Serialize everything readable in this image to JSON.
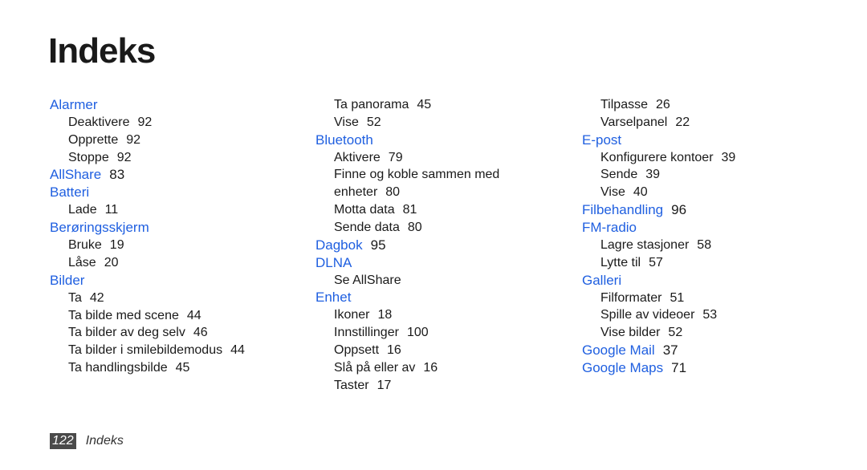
{
  "title": "Indeks",
  "footer": {
    "page_number": "122",
    "label": "Indeks"
  },
  "columns": [
    {
      "entries": [
        {
          "heading": "Alarmer",
          "page": "",
          "subs": [
            {
              "text": "Deaktivere",
              "page": "92"
            },
            {
              "text": "Opprette",
              "page": "92"
            },
            {
              "text": "Stoppe",
              "page": "92"
            }
          ]
        },
        {
          "heading": "AllShare",
          "page": "83",
          "subs": []
        },
        {
          "heading": "Batteri",
          "page": "",
          "subs": [
            {
              "text": "Lade",
              "page": "11"
            }
          ]
        },
        {
          "heading": "Berøringsskjerm",
          "page": "",
          "subs": [
            {
              "text": "Bruke",
              "page": "19"
            },
            {
              "text": "Låse",
              "page": "20"
            }
          ]
        },
        {
          "heading": "Bilder",
          "page": "",
          "subs": [
            {
              "text": "Ta",
              "page": "42"
            },
            {
              "text": "Ta bilde med scene",
              "page": "44"
            },
            {
              "text": "Ta bilder av deg selv",
              "page": "46"
            },
            {
              "text": "Ta bilder i smilebildemodus",
              "page": "44"
            },
            {
              "text": "Ta handlingsbilde",
              "page": "45"
            }
          ]
        }
      ]
    },
    {
      "continued": [
        {
          "text": "Ta panorama",
          "page": "45"
        },
        {
          "text": "Vise",
          "page": "52"
        }
      ],
      "entries": [
        {
          "heading": "Bluetooth",
          "page": "",
          "subs": [
            {
              "text": "Aktivere",
              "page": "79"
            },
            {
              "text": "Finne og koble sammen med enheter",
              "page": "80"
            },
            {
              "text": "Motta data",
              "page": "81"
            },
            {
              "text": "Sende data",
              "page": "80"
            }
          ]
        },
        {
          "heading": "Dagbok",
          "page": "95",
          "subs": []
        },
        {
          "heading": "DLNA",
          "page": "",
          "subs": [
            {
              "text": "Se AllShare",
              "page": ""
            }
          ]
        },
        {
          "heading": "Enhet",
          "page": "",
          "subs": [
            {
              "text": "Ikoner",
              "page": "18"
            },
            {
              "text": "Innstillinger",
              "page": "100"
            },
            {
              "text": "Oppsett",
              "page": "16"
            },
            {
              "text": "Slå på eller av",
              "page": "16"
            },
            {
              "text": "Taster",
              "page": "17"
            }
          ]
        }
      ]
    },
    {
      "continued": [
        {
          "text": "Tilpasse",
          "page": "26"
        },
        {
          "text": "Varselpanel",
          "page": "22"
        }
      ],
      "entries": [
        {
          "heading": "E-post",
          "page": "",
          "subs": [
            {
              "text": "Konfigurere kontoer",
              "page": "39"
            },
            {
              "text": "Sende",
              "page": "39"
            },
            {
              "text": "Vise",
              "page": "40"
            }
          ]
        },
        {
          "heading": "Filbehandling",
          "page": "96",
          "subs": []
        },
        {
          "heading": "FM-radio",
          "page": "",
          "subs": [
            {
              "text": "Lagre stasjoner",
              "page": "58"
            },
            {
              "text": "Lytte til",
              "page": "57"
            }
          ]
        },
        {
          "heading": "Galleri",
          "page": "",
          "subs": [
            {
              "text": "Filformater",
              "page": "51"
            },
            {
              "text": "Spille av videoer",
              "page": "53"
            },
            {
              "text": "Vise bilder",
              "page": "52"
            }
          ]
        },
        {
          "heading": "Google Mail",
          "page": "37",
          "subs": []
        },
        {
          "heading": "Google Maps",
          "page": "71",
          "subs": []
        }
      ]
    }
  ]
}
